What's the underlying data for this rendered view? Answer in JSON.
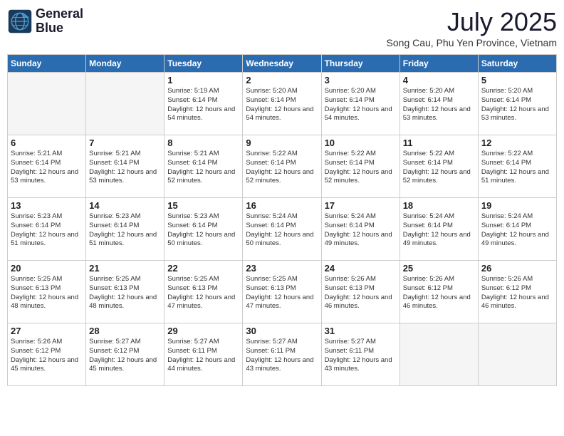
{
  "logo": {
    "line1": "General",
    "line2": "Blue"
  },
  "title": "July 2025",
  "subtitle": "Song Cau, Phu Yen Province, Vietnam",
  "weekdays": [
    "Sunday",
    "Monday",
    "Tuesday",
    "Wednesday",
    "Thursday",
    "Friday",
    "Saturday"
  ],
  "weeks": [
    [
      {
        "day": "",
        "info": ""
      },
      {
        "day": "",
        "info": ""
      },
      {
        "day": "1",
        "info": "Sunrise: 5:19 AM\nSunset: 6:14 PM\nDaylight: 12 hours and 54 minutes."
      },
      {
        "day": "2",
        "info": "Sunrise: 5:20 AM\nSunset: 6:14 PM\nDaylight: 12 hours and 54 minutes."
      },
      {
        "day": "3",
        "info": "Sunrise: 5:20 AM\nSunset: 6:14 PM\nDaylight: 12 hours and 54 minutes."
      },
      {
        "day": "4",
        "info": "Sunrise: 5:20 AM\nSunset: 6:14 PM\nDaylight: 12 hours and 53 minutes."
      },
      {
        "day": "5",
        "info": "Sunrise: 5:20 AM\nSunset: 6:14 PM\nDaylight: 12 hours and 53 minutes."
      }
    ],
    [
      {
        "day": "6",
        "info": "Sunrise: 5:21 AM\nSunset: 6:14 PM\nDaylight: 12 hours and 53 minutes."
      },
      {
        "day": "7",
        "info": "Sunrise: 5:21 AM\nSunset: 6:14 PM\nDaylight: 12 hours and 53 minutes."
      },
      {
        "day": "8",
        "info": "Sunrise: 5:21 AM\nSunset: 6:14 PM\nDaylight: 12 hours and 52 minutes."
      },
      {
        "day": "9",
        "info": "Sunrise: 5:22 AM\nSunset: 6:14 PM\nDaylight: 12 hours and 52 minutes."
      },
      {
        "day": "10",
        "info": "Sunrise: 5:22 AM\nSunset: 6:14 PM\nDaylight: 12 hours and 52 minutes."
      },
      {
        "day": "11",
        "info": "Sunrise: 5:22 AM\nSunset: 6:14 PM\nDaylight: 12 hours and 52 minutes."
      },
      {
        "day": "12",
        "info": "Sunrise: 5:22 AM\nSunset: 6:14 PM\nDaylight: 12 hours and 51 minutes."
      }
    ],
    [
      {
        "day": "13",
        "info": "Sunrise: 5:23 AM\nSunset: 6:14 PM\nDaylight: 12 hours and 51 minutes."
      },
      {
        "day": "14",
        "info": "Sunrise: 5:23 AM\nSunset: 6:14 PM\nDaylight: 12 hours and 51 minutes."
      },
      {
        "day": "15",
        "info": "Sunrise: 5:23 AM\nSunset: 6:14 PM\nDaylight: 12 hours and 50 minutes."
      },
      {
        "day": "16",
        "info": "Sunrise: 5:24 AM\nSunset: 6:14 PM\nDaylight: 12 hours and 50 minutes."
      },
      {
        "day": "17",
        "info": "Sunrise: 5:24 AM\nSunset: 6:14 PM\nDaylight: 12 hours and 49 minutes."
      },
      {
        "day": "18",
        "info": "Sunrise: 5:24 AM\nSunset: 6:14 PM\nDaylight: 12 hours and 49 minutes."
      },
      {
        "day": "19",
        "info": "Sunrise: 5:24 AM\nSunset: 6:14 PM\nDaylight: 12 hours and 49 minutes."
      }
    ],
    [
      {
        "day": "20",
        "info": "Sunrise: 5:25 AM\nSunset: 6:13 PM\nDaylight: 12 hours and 48 minutes."
      },
      {
        "day": "21",
        "info": "Sunrise: 5:25 AM\nSunset: 6:13 PM\nDaylight: 12 hours and 48 minutes."
      },
      {
        "day": "22",
        "info": "Sunrise: 5:25 AM\nSunset: 6:13 PM\nDaylight: 12 hours and 47 minutes."
      },
      {
        "day": "23",
        "info": "Sunrise: 5:25 AM\nSunset: 6:13 PM\nDaylight: 12 hours and 47 minutes."
      },
      {
        "day": "24",
        "info": "Sunrise: 5:26 AM\nSunset: 6:13 PM\nDaylight: 12 hours and 46 minutes."
      },
      {
        "day": "25",
        "info": "Sunrise: 5:26 AM\nSunset: 6:12 PM\nDaylight: 12 hours and 46 minutes."
      },
      {
        "day": "26",
        "info": "Sunrise: 5:26 AM\nSunset: 6:12 PM\nDaylight: 12 hours and 46 minutes."
      }
    ],
    [
      {
        "day": "27",
        "info": "Sunrise: 5:26 AM\nSunset: 6:12 PM\nDaylight: 12 hours and 45 minutes."
      },
      {
        "day": "28",
        "info": "Sunrise: 5:27 AM\nSunset: 6:12 PM\nDaylight: 12 hours and 45 minutes."
      },
      {
        "day": "29",
        "info": "Sunrise: 5:27 AM\nSunset: 6:11 PM\nDaylight: 12 hours and 44 minutes."
      },
      {
        "day": "30",
        "info": "Sunrise: 5:27 AM\nSunset: 6:11 PM\nDaylight: 12 hours and 43 minutes."
      },
      {
        "day": "31",
        "info": "Sunrise: 5:27 AM\nSunset: 6:11 PM\nDaylight: 12 hours and 43 minutes."
      },
      {
        "day": "",
        "info": ""
      },
      {
        "day": "",
        "info": ""
      }
    ]
  ]
}
